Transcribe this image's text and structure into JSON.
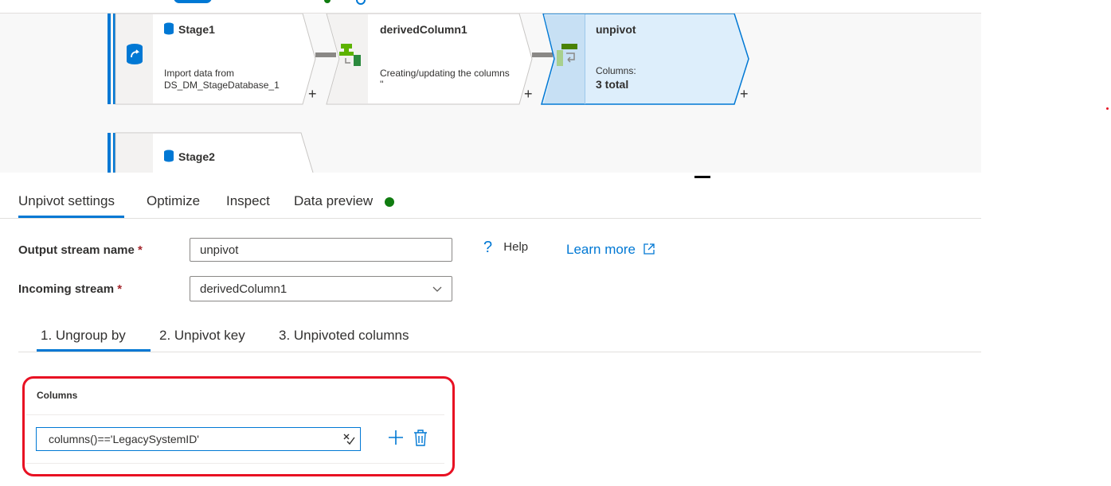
{
  "canvas": {
    "nodes": [
      {
        "title": "Stage1",
        "description_line1": "Import data from",
        "description_line2": "DS_DM_StageDatabase_1"
      },
      {
        "title": "derivedColumn1",
        "description_line1": "Creating/updating the columns",
        "description_line2": "''"
      },
      {
        "title": "unpivot",
        "description_line1": "Columns:",
        "description_line2": "3 total"
      },
      {
        "title": "Stage2"
      }
    ],
    "add_symbol": "+"
  },
  "tabs": [
    {
      "label": "Unpivot settings",
      "active": true
    },
    {
      "label": "Optimize"
    },
    {
      "label": "Inspect"
    },
    {
      "label": "Data preview",
      "status_color": "#107c10"
    }
  ],
  "form": {
    "output_stream_label": "Output stream name",
    "output_stream_value": "unpivot",
    "incoming_stream_label": "Incoming stream",
    "incoming_stream_value": "derivedColumn1",
    "required_marker": "*",
    "help_label": "Help",
    "learn_more_label": "Learn more"
  },
  "subtabs": [
    {
      "label": "1. Ungroup by",
      "active": true
    },
    {
      "label": "2. Unpivot key"
    },
    {
      "label": "3. Unpivoted columns"
    }
  ],
  "ungroup": {
    "columns_header": "Columns",
    "expression": "columns()=='LegacySystemID'"
  },
  "colors": {
    "accent": "#0078d4",
    "highlight": "#e81123",
    "status_ok": "#107c10"
  }
}
